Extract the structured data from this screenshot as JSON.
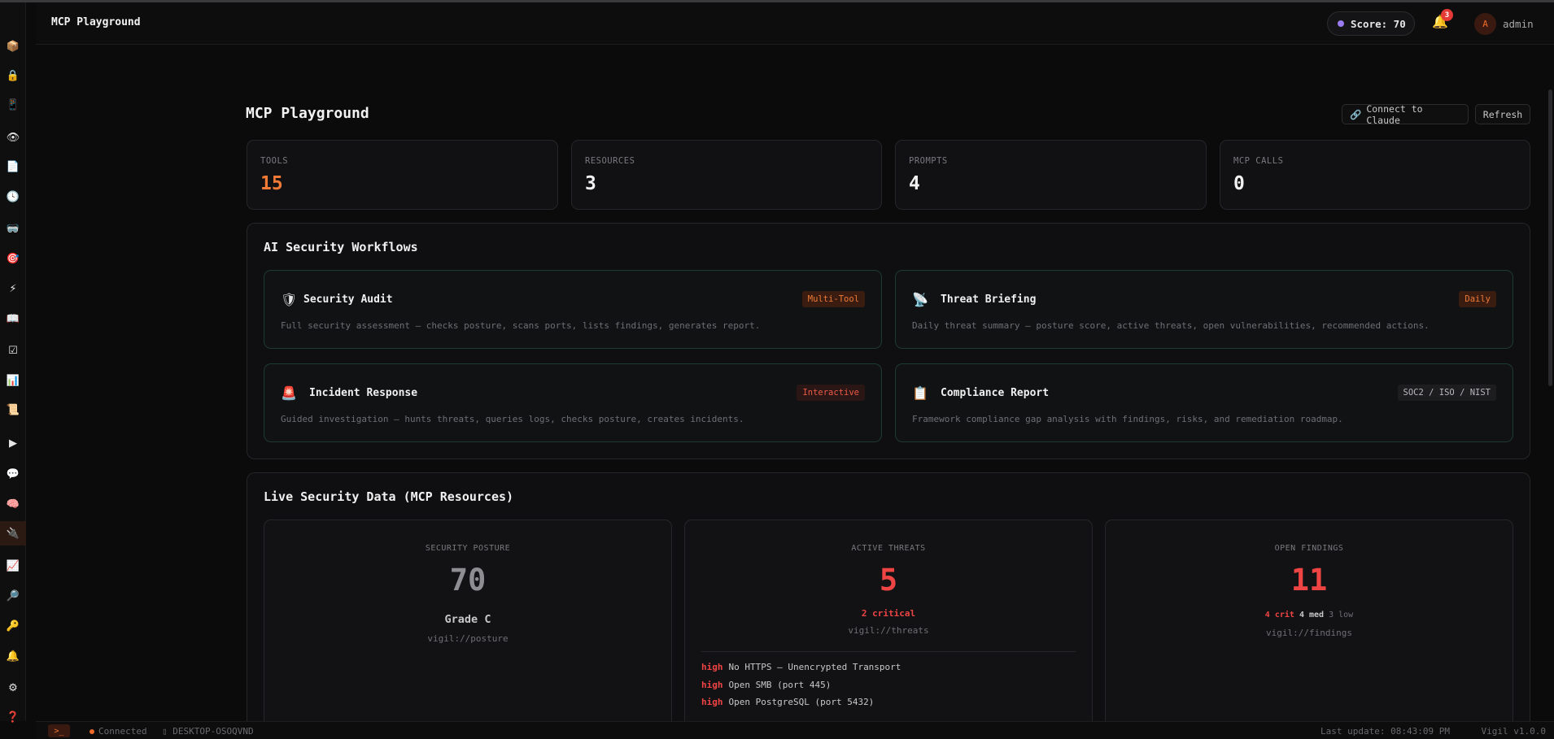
{
  "header": {
    "app_title": "MCP Playground",
    "score_label": "Score: 70",
    "notification_count": "3",
    "avatar_initial": "A",
    "username": "admin"
  },
  "sidebar": {
    "items": [
      {
        "name": "box-icon",
        "glyph": "📦"
      },
      {
        "name": "lock-icon",
        "glyph": "🔒"
      },
      {
        "name": "device-icon",
        "glyph": "📱"
      },
      {
        "name": "eye-icon",
        "glyph": "👁"
      },
      {
        "name": "document-icon",
        "glyph": "📄"
      },
      {
        "name": "clock-icon",
        "glyph": "🕓"
      },
      {
        "name": "mask-icon",
        "glyph": "🥽"
      },
      {
        "name": "target-icon",
        "glyph": "🎯"
      },
      {
        "name": "bolt-icon",
        "glyph": "⚡"
      },
      {
        "name": "book-icon",
        "glyph": "📖"
      },
      {
        "name": "checkbox-icon",
        "glyph": "☑"
      },
      {
        "name": "bar-chart-icon",
        "glyph": "📊"
      },
      {
        "name": "scroll-icon",
        "glyph": "📜"
      },
      {
        "name": "play-icon",
        "glyph": "▶"
      },
      {
        "name": "chat-icon",
        "glyph": "💬"
      },
      {
        "name": "brain-icon",
        "glyph": "🧠"
      },
      {
        "name": "plug-icon",
        "glyph": "🔌"
      },
      {
        "name": "chart-icon",
        "glyph": "📈"
      },
      {
        "name": "search-icon",
        "glyph": "🔎"
      },
      {
        "name": "key-icon",
        "glyph": "🔑"
      },
      {
        "name": "bell-icon",
        "glyph": "🔔"
      },
      {
        "name": "gear-icon",
        "glyph": "⚙"
      },
      {
        "name": "help-icon",
        "glyph": "❓"
      }
    ]
  },
  "page": {
    "title": "MCP Playground",
    "connect_label": "Connect to Claude",
    "refresh_label": "Refresh"
  },
  "stats": [
    {
      "label": "TOOLS",
      "value": "15"
    },
    {
      "label": "RESOURCES",
      "value": "3"
    },
    {
      "label": "PROMPTS",
      "value": "4"
    },
    {
      "label": "MCP CALLS",
      "value": "0"
    }
  ],
  "workflows": {
    "title": "AI Security Workflows",
    "items": [
      {
        "icon": "🛡",
        "name": "Security Audit",
        "tag": "Multi-Tool",
        "desc": "Full security assessment — checks posture, scans ports, lists findings, generates report."
      },
      {
        "icon": "📡",
        "name": "Threat Briefing",
        "tag": "Daily",
        "desc": "Daily threat summary — posture score, active threats, open vulnerabilities, recommended actions."
      },
      {
        "icon": "🚨",
        "name": "Incident Response",
        "tag": "Interactive",
        "desc": "Guided investigation — hunts threats, queries logs, checks posture, creates incidents."
      },
      {
        "icon": "📋",
        "name": "Compliance Report",
        "tag": "SOC2 / ISO / NIST",
        "desc": "Framework compliance gap analysis with findings, risks, and remediation roadmap."
      }
    ]
  },
  "live": {
    "title": "Live Security Data (MCP Resources)",
    "posture": {
      "label": "SECURITY POSTURE",
      "value": "70",
      "grade": "Grade C",
      "uri": "vigil://posture"
    },
    "threats": {
      "label": "ACTIVE THREATS",
      "value": "5",
      "critical": "2 critical",
      "uri": "vigil://threats",
      "list": [
        {
          "sev": "high",
          "text": "No HTTPS — Unencrypted Transport"
        },
        {
          "sev": "high",
          "text": "Open SMB (port 445)"
        },
        {
          "sev": "high",
          "text": "Open PostgreSQL (port 5432)"
        }
      ]
    },
    "findings": {
      "label": "OPEN FINDINGS",
      "value": "11",
      "crit": "4 crit",
      "med": "4 med",
      "low": "3 low",
      "uri": "vigil://findings"
    }
  },
  "footer": {
    "terminal_glyph": ">_",
    "status": "Connected",
    "host": "DESKTOP-OSOQVND",
    "last_update": "Last update: 08:43:09 PM",
    "version": "Vigil v1.0.0"
  },
  "colors": {
    "accent": "#f07a36",
    "danger": "#ef4444",
    "score_dot": "#9b7cf0",
    "card_border_green": "#1f3a30"
  }
}
